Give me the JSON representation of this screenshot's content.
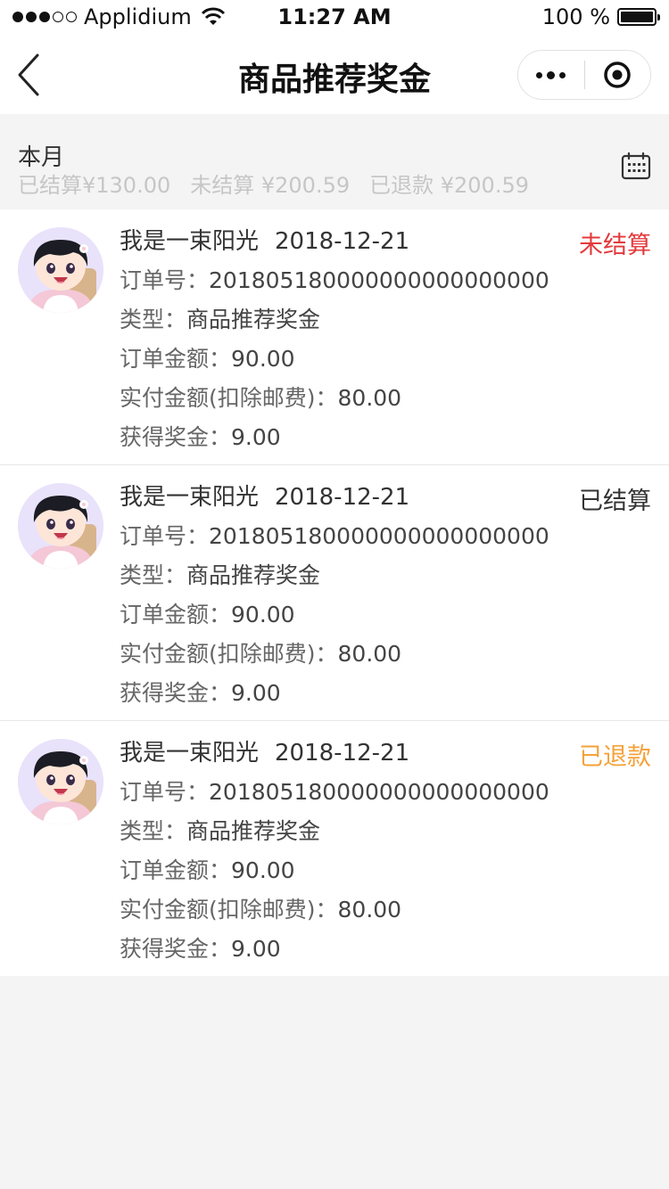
{
  "status_bar": {
    "carrier": "Applidium",
    "time": "11:27 AM",
    "battery": "100 %"
  },
  "nav": {
    "title": "商品推荐奖金",
    "back_icon": "chevron-left-icon",
    "more_icon": "more-dots-icon",
    "close_icon": "target-circle-icon"
  },
  "filter": {
    "month_label": "本月",
    "settled": "已结算¥130.00",
    "unsettled": "未结算 ¥200.59",
    "refunded": "已退款 ¥200.59",
    "calendar_icon": "calendar-icon"
  },
  "colors": {
    "unsettled": "#e4393c",
    "settled": "#333333",
    "refunded": "#f5a23a"
  },
  "labels": {
    "order_no": "订单号：",
    "type": "类型：",
    "order_amount": "订单金额：",
    "paid_amount": "实付金额(扣除邮费)：",
    "bonus": "获得奖金："
  },
  "records": [
    {
      "name": "我是一束阳光",
      "date": "2018-12-21",
      "status": "未结算",
      "status_color": "#e4393c",
      "order_no": "201805180000000000000000",
      "type": "商品推荐奖金",
      "order_amount": "90.00",
      "paid_amount": "80.00",
      "bonus": "9.00"
    },
    {
      "name": "我是一束阳光",
      "date": "2018-12-21",
      "status": "已结算",
      "status_color": "#333333",
      "order_no": "201805180000000000000000",
      "type": "商品推荐奖金",
      "order_amount": "90.00",
      "paid_amount": "80.00",
      "bonus": "9.00"
    },
    {
      "name": "我是一束阳光",
      "date": "2018-12-21",
      "status": "已退款",
      "status_color": "#f5a23a",
      "order_no": "201805180000000000000000",
      "type": "商品推荐奖金",
      "order_amount": "90.00",
      "paid_amount": "80.00",
      "bonus": "9.00"
    }
  ]
}
